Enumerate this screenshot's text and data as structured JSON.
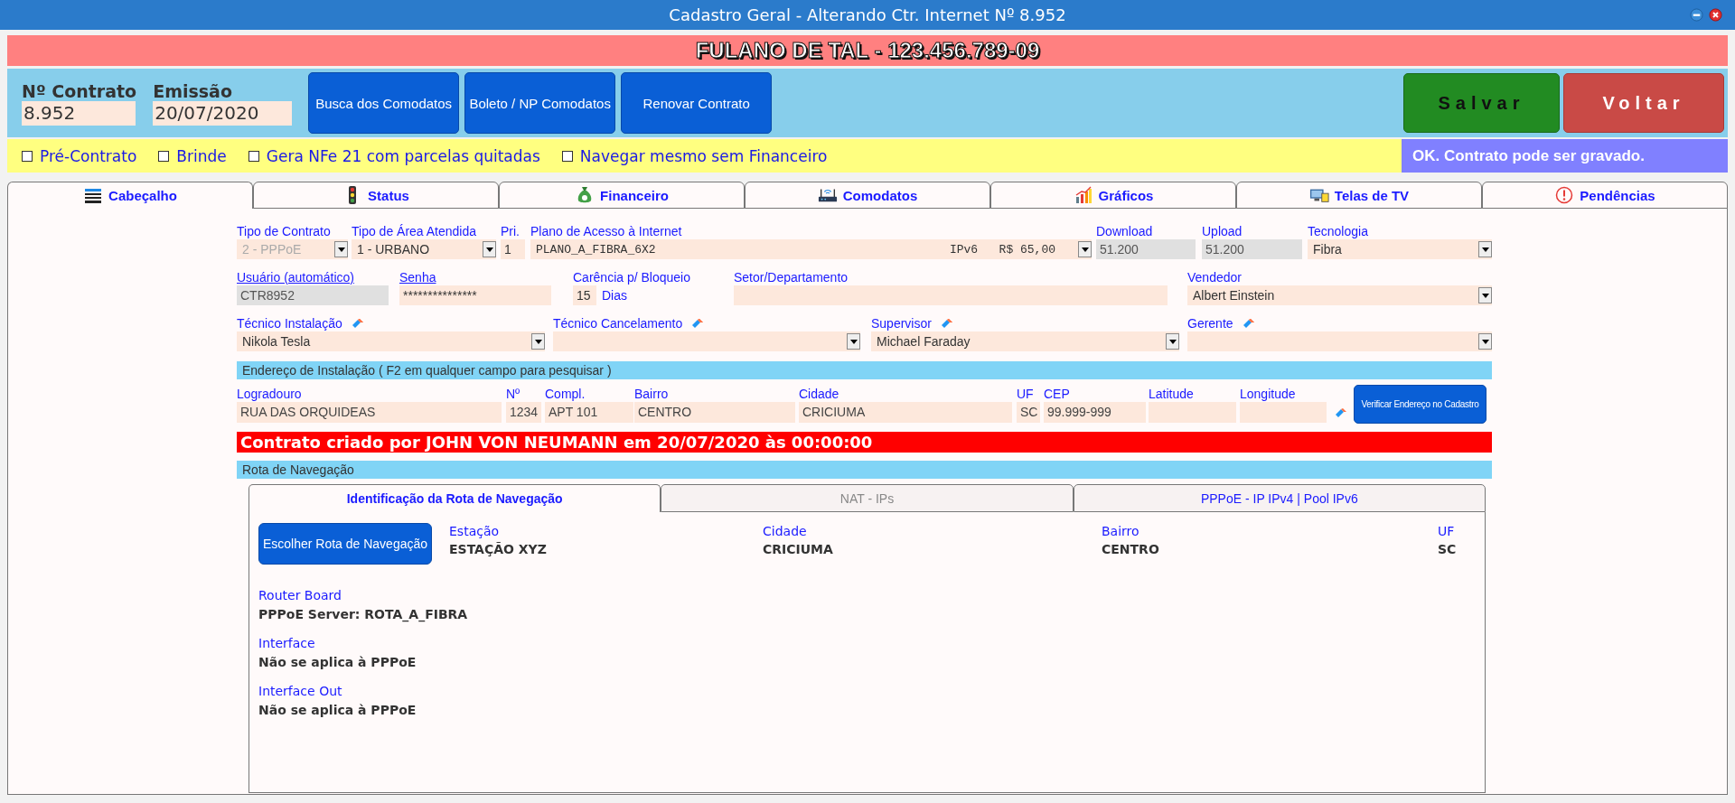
{
  "window": {
    "title": "Cadastro Geral - Alterando Ctr. Internet Nº 8.952"
  },
  "customer_banner": "FULANO DE TAL - 123.456.789-09",
  "header": {
    "contract": {
      "label": "Nº Contrato",
      "value": "8.952"
    },
    "issue": {
      "label": "Emissão",
      "value": "20/07/2020"
    },
    "actions": [
      "Busca dos Comodatos",
      "Boleto / NP Comodatos",
      "Renovar Contrato"
    ],
    "save": "Salvar",
    "back": "Voltar"
  },
  "options": [
    {
      "label": "Pré-Contrato",
      "checked": false
    },
    {
      "label": "Brinde",
      "checked": false
    },
    {
      "label": "Gera NFe 21 com parcelas quitadas",
      "checked": false
    },
    {
      "label": "Navegar mesmo sem Financeiro",
      "checked": false
    }
  ],
  "status_message": "OK. Contrato pode ser gravado.",
  "tabs": [
    {
      "label": "Cabeçalho",
      "selected": true
    },
    {
      "label": "Status",
      "selected": false
    },
    {
      "label": "Financeiro",
      "selected": false
    },
    {
      "label": "Comodatos",
      "selected": false
    },
    {
      "label": "Gráficos",
      "selected": false
    },
    {
      "label": "Telas de TV",
      "selected": false
    },
    {
      "label": "Pendências",
      "selected": false
    }
  ],
  "form_rows": [
    [
      {
        "label": "Tipo de Contrato",
        "value": "2 - PPPoE",
        "kind": "select",
        "readonly": true
      },
      {
        "label": "Tipo de Área Atendida",
        "value": "1 - URBANO",
        "kind": "select",
        "readonly": false
      },
      {
        "label": "Pri.",
        "value": "1",
        "kind": "input",
        "readonly": false
      },
      {
        "label": "Plano de Acesso à Internet",
        "value": "PLANO_A_FIBRA_6X2",
        "detail": "IPv6   R$ 65,00",
        "kind": "select",
        "readonly": false
      },
      {
        "label": "Download",
        "value": "51.200",
        "kind": "input",
        "readonly": true
      },
      {
        "label": "Upload",
        "value": "51.200",
        "kind": "input",
        "readonly": true
      },
      {
        "label": "Tecnologia",
        "value": "Fibra",
        "kind": "select",
        "readonly": false
      }
    ],
    [
      {
        "label": "Usuário (automático)",
        "link": true,
        "value": "CTR8952",
        "kind": "input",
        "readonly": true
      },
      {
        "label": "Senha",
        "link": true,
        "value": "***************",
        "kind": "input",
        "readonly": false
      },
      {
        "label": "Carência p/ Bloqueio",
        "value": "15",
        "suffix": "Dias",
        "kind": "input",
        "readonly": false
      },
      {
        "label": "Setor/Departamento",
        "kind": "input",
        "readonly": false
      },
      {
        "label": "Vendedor",
        "value": "Albert Einstein",
        "kind": "select",
        "readonly": false
      }
    ],
    [
      {
        "label": "Técnico Instalação",
        "eraser": true,
        "value": "Nikola Tesla",
        "kind": "select",
        "readonly": false
      },
      {
        "label": "Técnico Cancelamento",
        "eraser": true,
        "kind": "select",
        "readonly": false
      },
      {
        "label": "Supervisor",
        "eraser": true,
        "value": "Michael Faraday",
        "kind": "select",
        "readonly": false
      },
      {
        "label": "Gerente",
        "eraser": true,
        "kind": "select",
        "readonly": false
      }
    ]
  ],
  "address": {
    "title": "Endereço de Instalação ( F2 em qualquer campo para pesquisar )",
    "fields": [
      {
        "label": "Logradouro",
        "value": "RUA DAS ORQUIDEAS"
      },
      {
        "label": "Nº",
        "value": "1234"
      },
      {
        "label": "Compl.",
        "value": "APT 101"
      },
      {
        "label": "Bairro",
        "value": "CENTRO"
      },
      {
        "label": "Cidade",
        "value": "CRICIUMA"
      },
      {
        "label": "UF",
        "value": "SC"
      },
      {
        "label": "CEP",
        "value": "99.999-999"
      },
      {
        "label": "Latitude"
      },
      {
        "label": "Longitude"
      }
    ],
    "verify_button": "Verificar Endereço no Cadastro"
  },
  "created_notice": "Contrato criado por JOHN VON NEUMANN em 20/07/2020 às 00:00:00",
  "route": {
    "title": "Rota de Navegação",
    "tabs": [
      {
        "label": "Identificação da Rota de Navegação",
        "selected": true,
        "disabled": false
      },
      {
        "label": "NAT - IPs",
        "selected": false,
        "disabled": true
      },
      {
        "label": "PPPoE - IP IPv4 | Pool IPv6",
        "selected": false,
        "disabled": false
      }
    ],
    "choose_button": "Escolher Rota de Navegação",
    "summary": [
      {
        "label": "Estação",
        "value": "ESTAÇÃO XYZ"
      },
      {
        "label": "Cidade",
        "value": "CRICIUMA"
      },
      {
        "label": "Bairro",
        "value": "CENTRO"
      },
      {
        "label": "UF",
        "value": "SC"
      }
    ],
    "details": [
      {
        "label": "Router Board",
        "value": "PPPoE Server: ROTA_A_FIBRA"
      },
      {
        "label": "Interface",
        "value": "Não se aplica à PPPoE"
      },
      {
        "label": "Interface Out",
        "value": "Não se aplica à PPPoE"
      }
    ]
  }
}
